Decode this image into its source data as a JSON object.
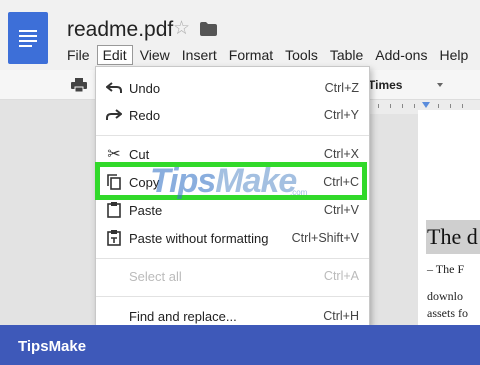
{
  "app": {
    "doc_title": "readme.pdf"
  },
  "menubar": {
    "items": [
      "File",
      "Edit",
      "View",
      "Insert",
      "Format",
      "Tools",
      "Table",
      "Add-ons",
      "Help"
    ],
    "active": "Edit"
  },
  "toolbar": {
    "font": "Times"
  },
  "edit_menu": {
    "items": [
      {
        "label": "Undo",
        "shortcut": "Ctrl+Z",
        "icon": "undo-icon",
        "enabled": true
      },
      {
        "label": "Redo",
        "shortcut": "Ctrl+Y",
        "icon": "redo-icon",
        "enabled": true
      },
      {
        "label": "Cut",
        "shortcut": "Ctrl+X",
        "icon": "scissors-icon",
        "enabled": true
      },
      {
        "label": "Copy",
        "shortcut": "Ctrl+C",
        "icon": "copy-icon",
        "enabled": true
      },
      {
        "label": "Paste",
        "shortcut": "Ctrl+V",
        "icon": "paste-icon",
        "enabled": true
      },
      {
        "label": "Paste without formatting",
        "shortcut": "Ctrl+Shift+V",
        "icon": "paste-plain-icon",
        "enabled": true
      },
      {
        "label": "Select all",
        "shortcut": "Ctrl+A",
        "icon": "",
        "enabled": false
      },
      {
        "label": "Find and replace...",
        "shortcut": "Ctrl+H",
        "icon": "",
        "enabled": true
      }
    ]
  },
  "document": {
    "heading": "The d",
    "line1": "– The F",
    "line2": "downlo",
    "line3": "assets fo"
  },
  "watermark": {
    "text_a": "Tips",
    "text_b": "Make",
    "suffix": ".com"
  },
  "footer": {
    "brand": "TipsMake"
  },
  "colors": {
    "accent": "#3e59b9",
    "highlight": "#31d92a",
    "doc_icon": "#3d6fd8"
  }
}
